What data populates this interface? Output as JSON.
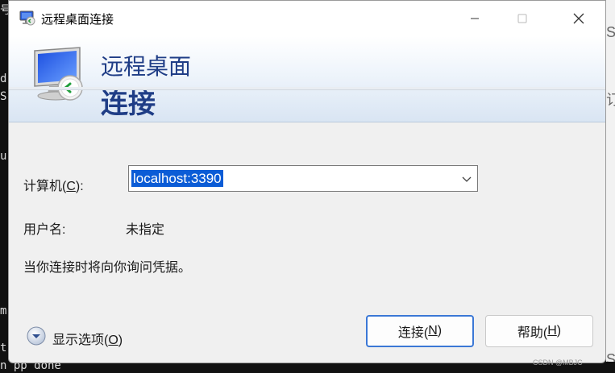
{
  "background": {
    "left_fragments": [
      "号",
      "d",
      "S",
      "u",
      "m",
      "t"
    ],
    "right_fragments": [
      "S",
      "订",
      "S"
    ],
    "bottom_fragment": "n pp done"
  },
  "titlebar": {
    "title": "远程桌面连接",
    "minimize": "minimize",
    "maximize": "maximize",
    "close": "close"
  },
  "banner": {
    "line1": "远程桌面",
    "line2": "连接"
  },
  "form": {
    "computer_label_prefix": "计算机(",
    "computer_label_key": "C",
    "computer_label_suffix": "):",
    "computer_value": "localhost:3390",
    "username_label": "用户名:",
    "username_value": "未指定",
    "note": "当你连接时将向你询问凭据。"
  },
  "footer": {
    "options_label_prefix": "显示选项(",
    "options_label_key": "O",
    "options_label_suffix": ")",
    "connect_prefix": "连接(",
    "connect_key": "N",
    "connect_suffix": ")",
    "help_prefix": "帮助(",
    "help_key": "H",
    "help_suffix": ")"
  },
  "watermark": "CSDN @MBJC",
  "colors": {
    "accent": "#1f3d86",
    "selection": "#0b5cd6",
    "primary_border": "#3b78d6"
  }
}
